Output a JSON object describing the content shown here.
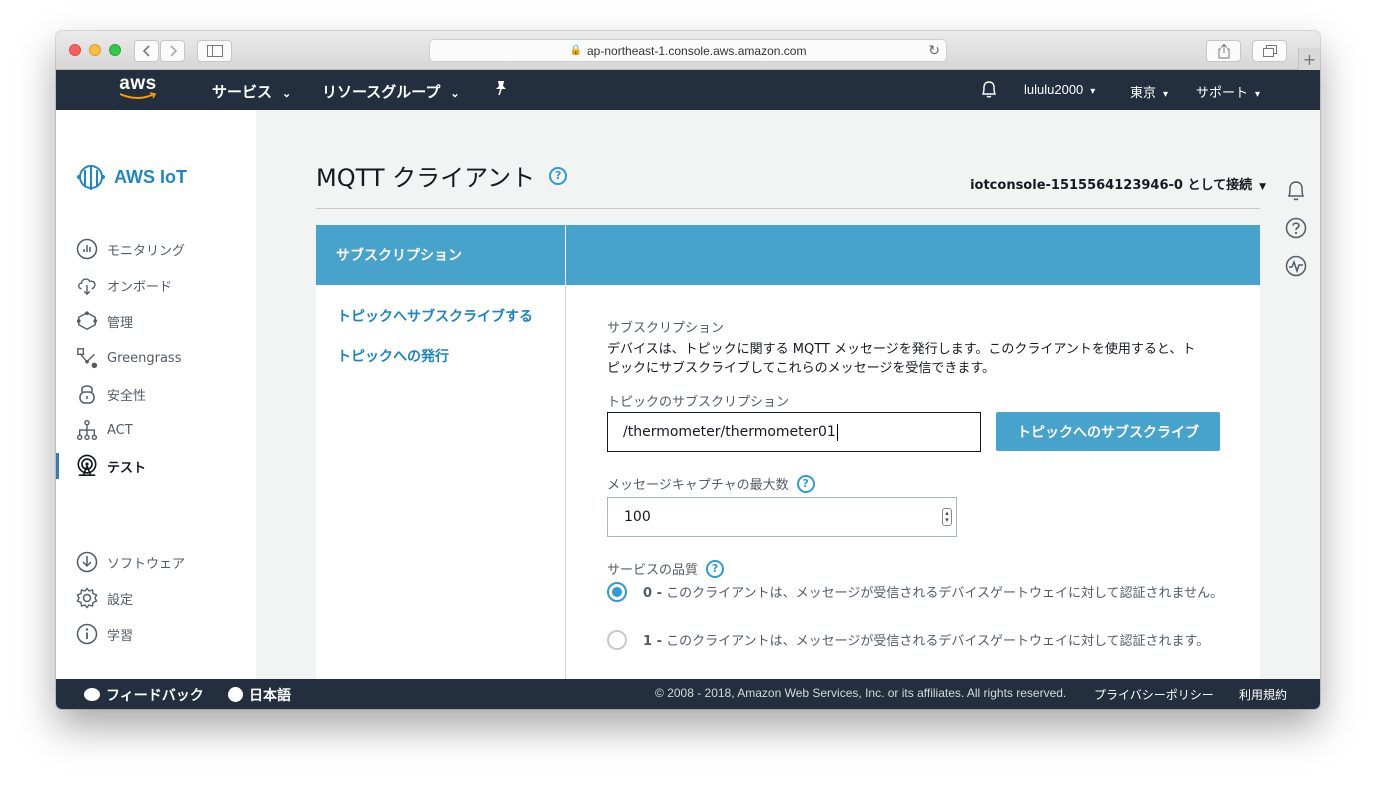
{
  "browser": {
    "url": "ap-northeast-1.console.aws.amazon.com",
    "new_tab": "+"
  },
  "aws_nav": {
    "logo": "aws",
    "services": "サービス",
    "resource_groups": "リソースグループ",
    "user": "lululu2000",
    "region": "東京",
    "support": "サポート"
  },
  "sidebar": {
    "brand": "AWS IoT",
    "items": [
      {
        "label": "モニタリング",
        "icon": "monitor-icon"
      },
      {
        "label": "オンボード",
        "icon": "cloud-icon"
      },
      {
        "label": "管理",
        "icon": "manage-icon"
      },
      {
        "label": "Greengrass",
        "icon": "greengrass-icon"
      },
      {
        "label": "安全性",
        "icon": "lock-icon"
      },
      {
        "label": "ACT",
        "icon": "act-icon"
      },
      {
        "label": "テスト",
        "icon": "test-icon",
        "active": true
      }
    ],
    "bottom_items": [
      {
        "label": "ソフトウェア",
        "icon": "download-icon"
      },
      {
        "label": "設定",
        "icon": "gear-icon"
      },
      {
        "label": "学習",
        "icon": "info-icon"
      }
    ]
  },
  "page": {
    "title": "MQTT クライアント",
    "help": "?",
    "connection": "iotconsole-1515564123946-0 として接続"
  },
  "panel": {
    "header_left": "サブスクリプション",
    "links": [
      "トピックへサブスクライブする",
      "トピックへの発行"
    ],
    "section_title": "サブスクリプション",
    "description": "デバイスは、トピックに関する MQTT メッセージを発行します。このクライアントを使用すると、トピックにサブスクライブしてこれらのメッセージを受信できます。",
    "topic_label": "トピックのサブスクリプション",
    "topic_value": "/thermometer/thermometer01",
    "subscribe_button": "トピックへのサブスクライブ",
    "max_capture_label": "メッセージキャプチャの最大数",
    "max_capture_value": "100",
    "qos_label": "サービスの品質",
    "qos_options": [
      {
        "value": "0 -",
        "text": "このクライアントは、メッセージが受信されるデバイスゲートウェイに対して認証されません。",
        "checked": true
      },
      {
        "value": "1 -",
        "text": "このクライアントは、メッセージが受信されるデバイスゲートウェイに対して認証されます。",
        "checked": false
      }
    ]
  },
  "footer": {
    "feedback": "フィードバック",
    "language": "日本語",
    "copyright": "© 2008 - 2018, Amazon Web Services, Inc. or its affiliates. All rights reserved.",
    "privacy": "プライバシーポリシー",
    "terms": "利用規約"
  },
  "colors": {
    "nav_bg": "#232f3e",
    "panel_header": "#48a3cc",
    "link": "#1e83c2"
  }
}
